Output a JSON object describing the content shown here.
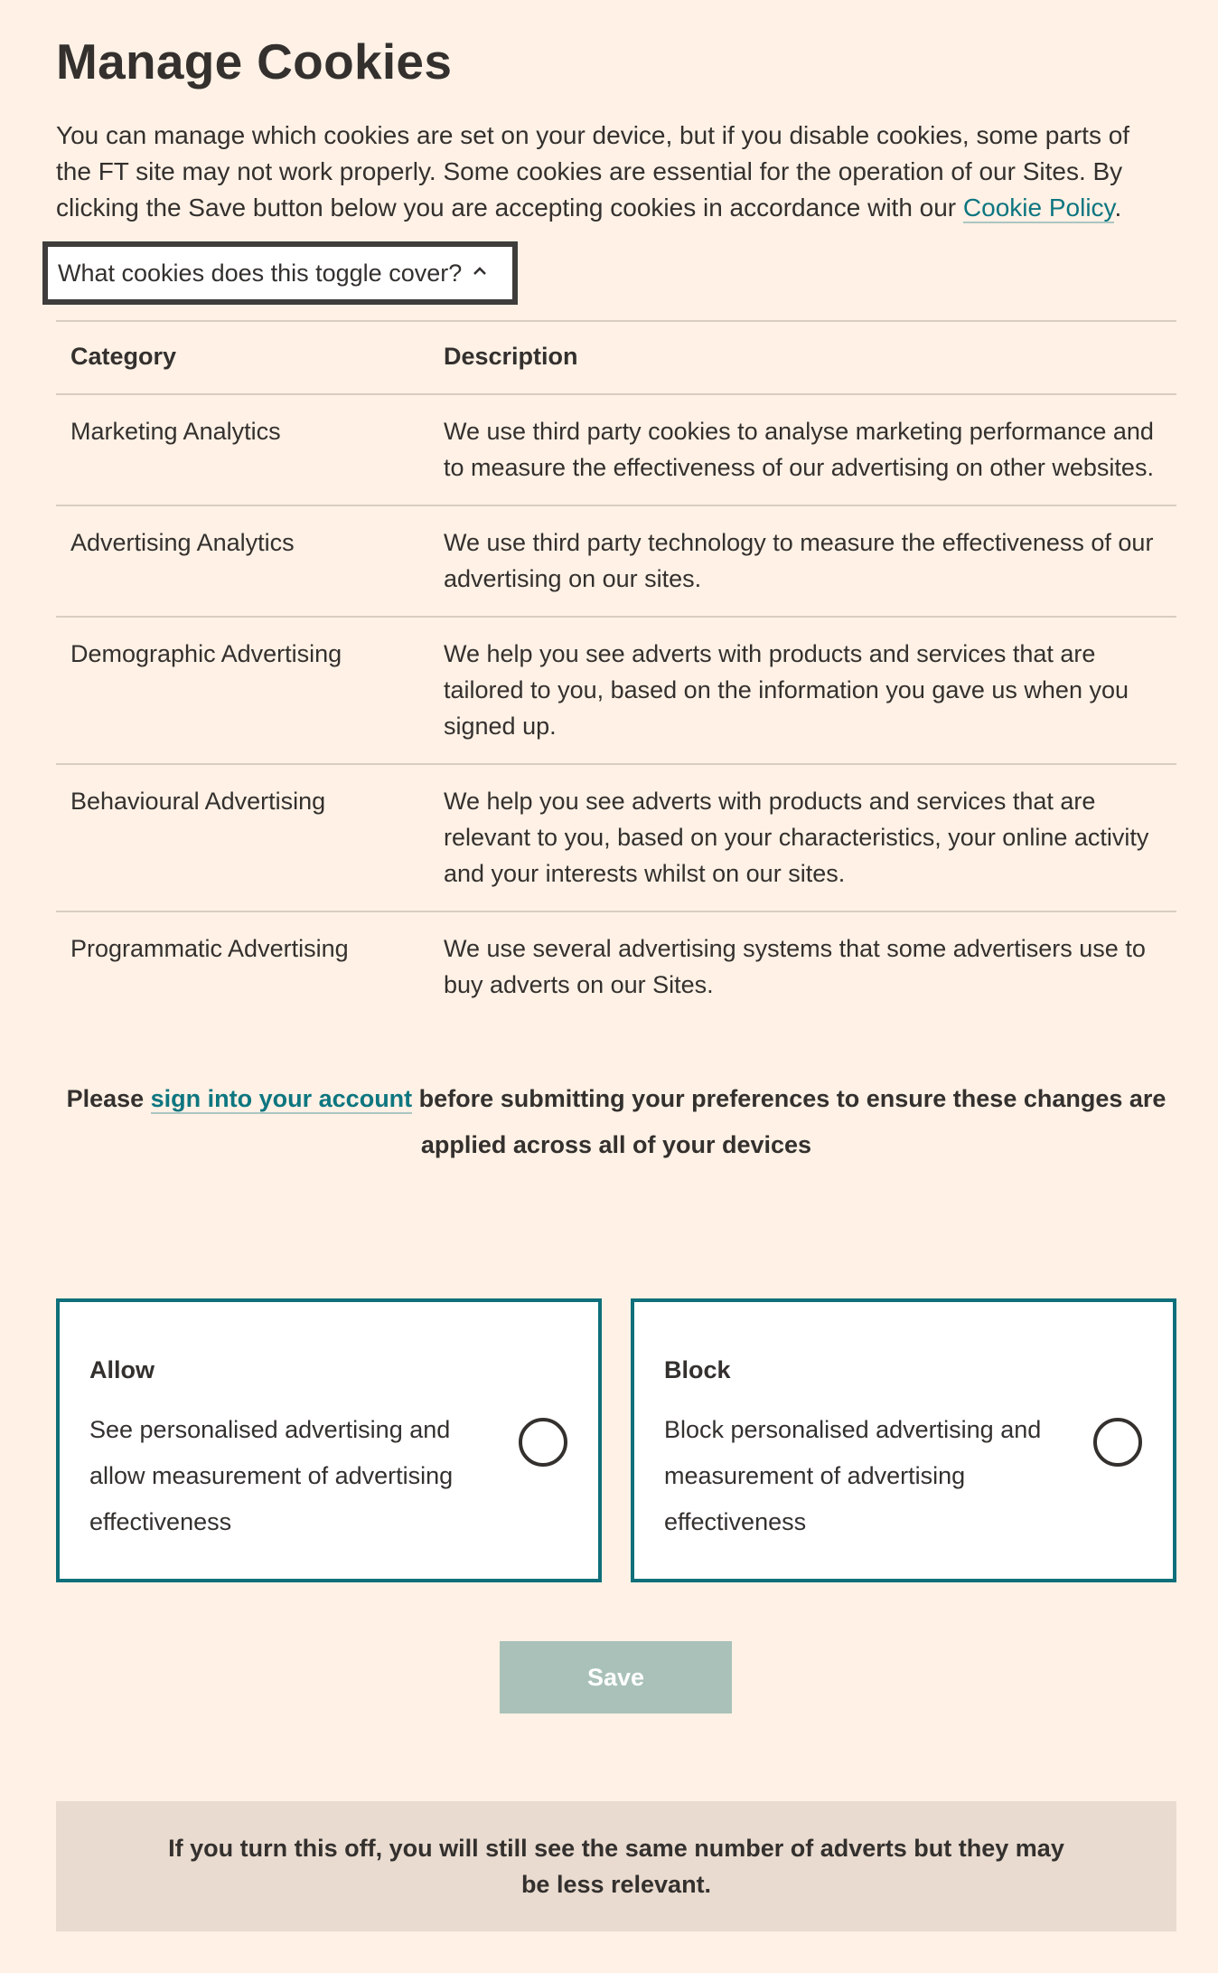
{
  "page_title": "Manage Cookies",
  "intro": {
    "text_before_link": "You can manage which cookies are set on your device, but if you disable cookies, some parts of the FT site may not work properly. Some cookies are essential for the operation of our Sites. By clicking the Save button below you are accepting cookies in accordance with our ",
    "link_label": "Cookie Policy",
    "text_after_link": "."
  },
  "toggle": {
    "label": "What cookies does this toggle cover?",
    "icon": "chevron-up-icon"
  },
  "table": {
    "headers": [
      "Category",
      "Description"
    ],
    "rows": [
      {
        "category": "Marketing Analytics",
        "description": "We use third party cookies to analyse marketing performance and to measure the effectiveness of our advertising on other websites."
      },
      {
        "category": "Advertising Analytics",
        "description": "We use third party technology to measure the effectiveness of our advertising on our sites."
      },
      {
        "category": "Demographic Advertising",
        "description": "We help you see adverts with products and services that are tailored to you, based on the information you gave us when you signed up."
      },
      {
        "category": "Behavioural Advertising",
        "description": "We help you see adverts with products and services that are relevant to you, based on your characteristics, your online activity and your interests whilst on our sites."
      },
      {
        "category": "Programmatic Advertising",
        "description": "We use several advertising systems that some advertisers use to buy adverts on our Sites."
      }
    ]
  },
  "notice": {
    "text_before_link": "Please ",
    "link_label": "sign into your account",
    "text_after_link": " before submitting your preferences to ensure these changes are applied across all of your devices"
  },
  "options": {
    "allow": {
      "title": "Allow",
      "description": "See personalised advertising and allow measurement of advertising effectiveness",
      "selected": false
    },
    "block": {
      "title": "Block",
      "description": "Block personalised advertising and measurement of advertising effectiveness",
      "selected": false
    }
  },
  "save_label": "Save",
  "footer_note": "If you turn this off, you will still see the same number of adverts but they may be less relevant.",
  "colors": {
    "background": "#fff1e5",
    "accent": "#0d7680",
    "option_border": "#0f6f7a",
    "save_disabled": "#a9c1b8",
    "footer_bg": "#e9dbcf"
  }
}
